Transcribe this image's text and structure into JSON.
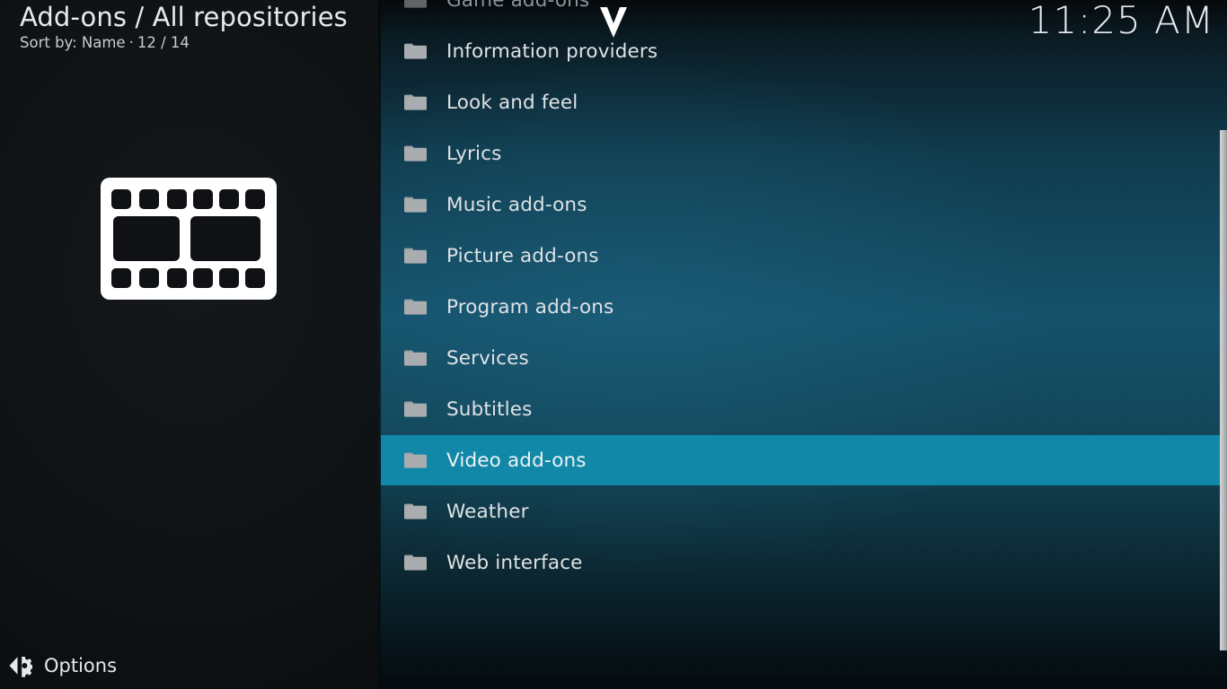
{
  "header": {
    "title": "Add-ons / All repositories",
    "sort_label": "Sort by: Name",
    "separator": "·",
    "count": "12 / 14",
    "clock": "11:25 AM"
  },
  "thumbnail": {
    "icon": "film-strip-icon"
  },
  "footer": {
    "options_label": "Options",
    "options_icon": "options-gear-icon"
  },
  "list": {
    "scroll_indicator": "chevron-down-icon",
    "folder_icon": "folder-icon",
    "selected_index": 9,
    "items": [
      {
        "label": "Game add-ons",
        "state": "dimmed"
      },
      {
        "label": "Information providers",
        "state": "normal"
      },
      {
        "label": "Look and feel",
        "state": "normal"
      },
      {
        "label": "Lyrics",
        "state": "normal"
      },
      {
        "label": "Music add-ons",
        "state": "normal"
      },
      {
        "label": "Picture add-ons",
        "state": "normal"
      },
      {
        "label": "Program add-ons",
        "state": "normal"
      },
      {
        "label": "Services",
        "state": "normal"
      },
      {
        "label": "Subtitles",
        "state": "normal"
      },
      {
        "label": "Video add-ons",
        "state": "selected"
      },
      {
        "label": "Weather",
        "state": "normal"
      },
      {
        "label": "Web interface",
        "state": "normal"
      }
    ]
  },
  "colors": {
    "highlight": "#1188a8",
    "panel_teal": "#15526b",
    "panel_dark": "#111417",
    "text": "#dfe2e5",
    "scrollbar": "#c0c3c5"
  }
}
